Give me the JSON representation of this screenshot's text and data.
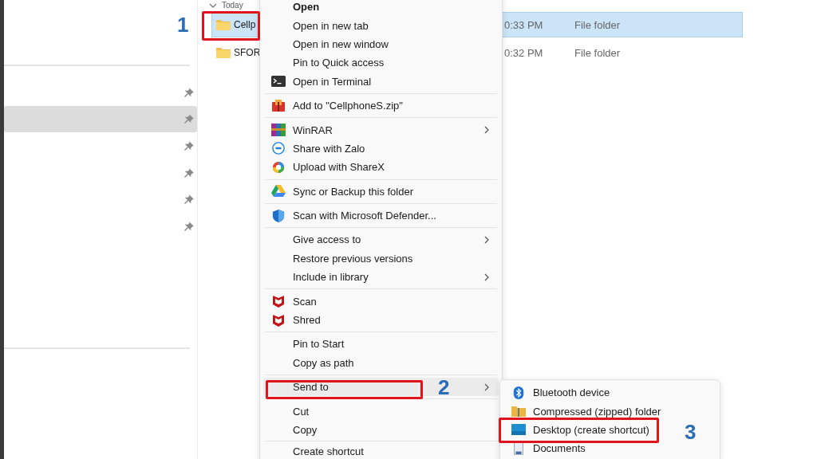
{
  "sidebar": {
    "items": [
      {
        "pinned": true,
        "selected": false
      },
      {
        "pinned": true,
        "selected": true
      },
      {
        "pinned": true,
        "selected": false
      },
      {
        "pinned": true,
        "selected": false
      },
      {
        "pinned": true,
        "selected": false
      },
      {
        "pinned": true,
        "selected": false
      }
    ]
  },
  "file_list": {
    "group": "Today",
    "rows": [
      {
        "name": "Cellp",
        "modified": "0:33 PM",
        "type": "File folder",
        "selected": true
      },
      {
        "name": "SFOR",
        "modified": "0:32 PM",
        "type": "File folder",
        "selected": false
      }
    ]
  },
  "context_menu": {
    "sections": [
      [
        {
          "label": "Open",
          "default": true,
          "selected": false
        },
        {
          "label": "Open in new tab",
          "selected": false
        },
        {
          "label": "Open in new window",
          "selected": false
        },
        {
          "label": "Pin to Quick access",
          "selected": false
        },
        {
          "label": "Open in Terminal",
          "kind": "terminal",
          "selected": false
        }
      ],
      [
        {
          "label": "Add to \"CellphoneS.zip\"",
          "kind": "archive",
          "selected": false
        }
      ],
      [
        {
          "label": "WinRAR",
          "kind": "books",
          "submenu": true,
          "selected": false
        },
        {
          "label": "Share with Zalo",
          "kind": "chat",
          "selected": false
        },
        {
          "label": "Upload with ShareX",
          "kind": "ring",
          "selected": false
        }
      ],
      [
        {
          "label": "Sync or Backup this folder",
          "kind": "drive",
          "selected": false
        }
      ],
      [
        {
          "label": "Scan with Microsoft Defender...",
          "kind": "shield",
          "selected": false
        }
      ],
      [
        {
          "label": "Give access to",
          "submenu": true,
          "selected": false
        },
        {
          "label": "Restore previous versions",
          "selected": false
        },
        {
          "label": "Include in library",
          "submenu": true,
          "selected": false
        }
      ],
      [
        {
          "label": "Scan",
          "kind": "badge",
          "selected": false
        },
        {
          "label": "Shred",
          "kind": "badge",
          "selected": false
        }
      ],
      [
        {
          "label": "Pin to Start",
          "selected": false
        },
        {
          "label": "Copy as path",
          "selected": false
        }
      ],
      [
        {
          "label": "Send to",
          "submenu": true,
          "selected": true
        }
      ],
      [
        {
          "label": "Cut",
          "selected": false
        },
        {
          "label": "Copy",
          "selected": false
        }
      ],
      [
        {
          "label": "Create shortcut",
          "selected": false
        }
      ]
    ]
  },
  "send_to_menu": {
    "items": [
      {
        "label": "Bluetooth device",
        "kind": "bluetooth"
      },
      {
        "label": "Compressed (zipped) folder",
        "kind": "zip"
      },
      {
        "label": "Desktop (create shortcut)",
        "kind": "desktop"
      },
      {
        "label": "Documents",
        "kind": "document"
      }
    ]
  },
  "annotations": [
    {
      "number": "1"
    },
    {
      "number": "2"
    },
    {
      "number": "3"
    }
  ]
}
